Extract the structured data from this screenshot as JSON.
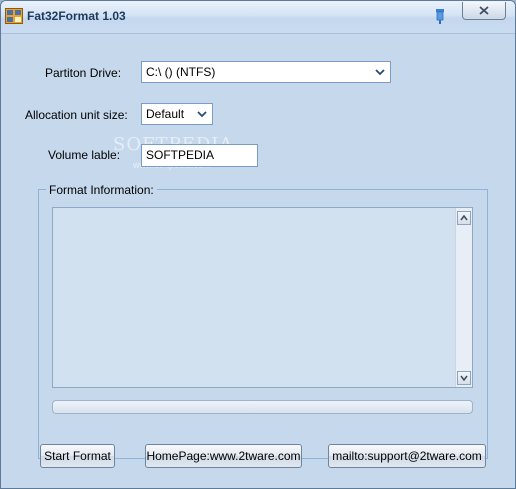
{
  "window": {
    "title": "Fat32Format 1.03",
    "icons": {
      "app": "fat32format-app-icon",
      "pin": "pin-icon",
      "close": "close-icon"
    }
  },
  "form": {
    "partition_label": "Partiton Drive:",
    "partition_value": "C:\\  ()  (NTFS)",
    "allocation_label": "Allocation unit size:",
    "allocation_value": "Default",
    "volume_label": "Volume lable:",
    "volume_value": "SOFTPEDIA"
  },
  "format_info": {
    "legend": "Format Information:",
    "text": "",
    "progress_fraction": 0
  },
  "buttons": {
    "start": "Start Format",
    "homepage": "HomePage:www.2tware.com",
    "mailto": "mailto:support@2tware.com"
  },
  "watermark": {
    "main": "SOFTPEDIA",
    "sub": "www.softpedia.com"
  },
  "colors": {
    "client_bg": "#c6d9ec",
    "accent_border": "#7a9cc5"
  }
}
